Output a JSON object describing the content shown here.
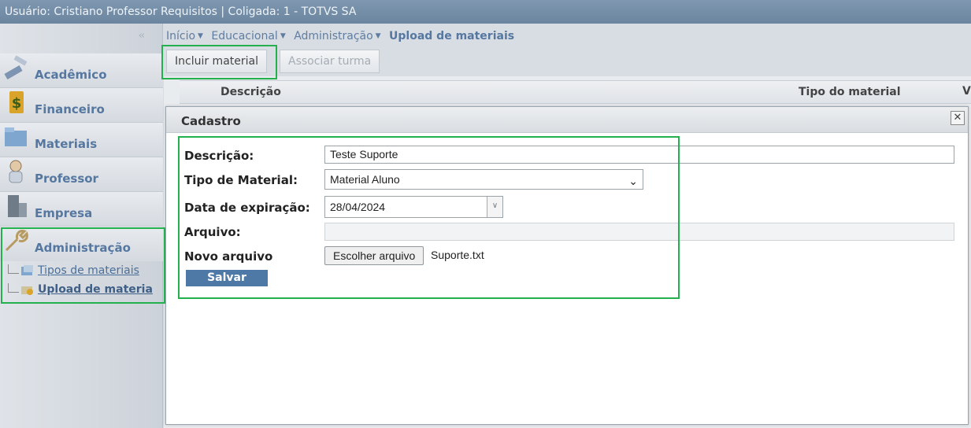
{
  "topbar": {
    "text": "Usuário: Cristiano Professor Requisitos  |  Coligada: 1 - TOTVS SA"
  },
  "sidebar": {
    "collapse": "‹‹",
    "items": [
      {
        "label": "Acadêmico",
        "icon": "brush-icon"
      },
      {
        "label": "Financeiro",
        "icon": "money-icon"
      },
      {
        "label": "Materiais",
        "icon": "folder-icon"
      },
      {
        "label": "Professor",
        "icon": "professor-icon"
      },
      {
        "label": "Empresa",
        "icon": "building-icon"
      },
      {
        "label": "Administração",
        "icon": "wrench-icon"
      }
    ],
    "sub_items": [
      {
        "label": "Tipos de materiais"
      },
      {
        "label": "Upload de materia"
      }
    ]
  },
  "breadcrumb": {
    "items": [
      "Início",
      "Educacional",
      "Administração"
    ],
    "current": "Upload de materiais"
  },
  "toolbar": {
    "add_label": "Incluir material",
    "assoc_label": "Associar turma"
  },
  "grid": {
    "col_description": "Descrição",
    "col_type": "Tipo do material",
    "col_partial": "V"
  },
  "dialog": {
    "title": "Cadastro",
    "close": "✕",
    "fields": {
      "descricao_label": "Descrição:",
      "descricao_value": "Teste Suporte",
      "tipo_label": "Tipo de Material:",
      "tipo_value": "Material Aluno",
      "data_label": "Data de expiração:",
      "data_value": "28/04/2024",
      "arquivo_label": "Arquivo:",
      "novo_label": "Novo arquivo",
      "file_button": "Escolher arquivo",
      "file_name": "Suporte.txt"
    },
    "save_label": "Salvar"
  },
  "colors": {
    "accent": "#4e79a7",
    "highlight": "#22b14c",
    "topbar": "#7f98b0"
  }
}
